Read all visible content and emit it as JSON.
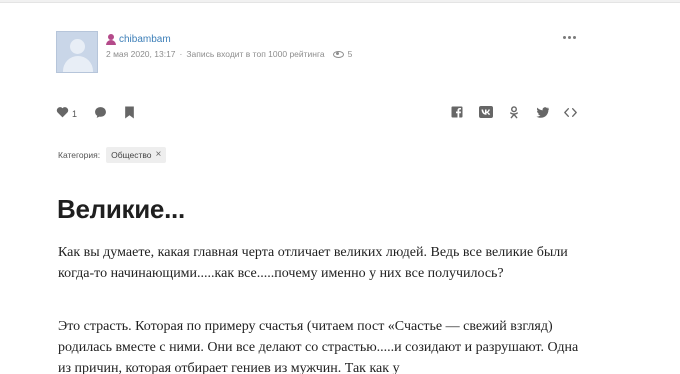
{
  "post": {
    "author": "chibambam",
    "date": "2 мая 2020, 13:17",
    "separator": "·",
    "rating_note": "Запись входит в топ 1000 рейтинга",
    "views": "5",
    "likes": "1"
  },
  "category": {
    "label": "Категория:",
    "tag": "Общество",
    "remove": "×"
  },
  "article": {
    "title": "Великие...",
    "paragraphs": [
      "Как вы думаете, какая главная черта отличает великих людей. Ведь все великие были когда-то начинающими.....как все.....почему именно у них все получилось?",
      "Это страсть. Которая по примеру счастья (читаем пост «Счастье — свежий взгляд) родилась вместе с ними. Они все делают со страстью.....и созидают и разрушают. Одна из причин, которая отбирает гениев из мужчин. Так как у"
    ]
  },
  "icons": {
    "like": "heart-icon",
    "comment": "comment-icon",
    "bookmark": "bookmark-icon",
    "facebook": "facebook-icon",
    "vk": "vk-icon",
    "ok": "odnoklassniki-icon",
    "twitter": "twitter-icon",
    "embed": "embed-code-icon",
    "more": "more-dots-icon"
  },
  "colors": {
    "author_link": "#3d7fb8",
    "user_icon": "#b44a8a",
    "meta_text": "#8d8d8d"
  }
}
